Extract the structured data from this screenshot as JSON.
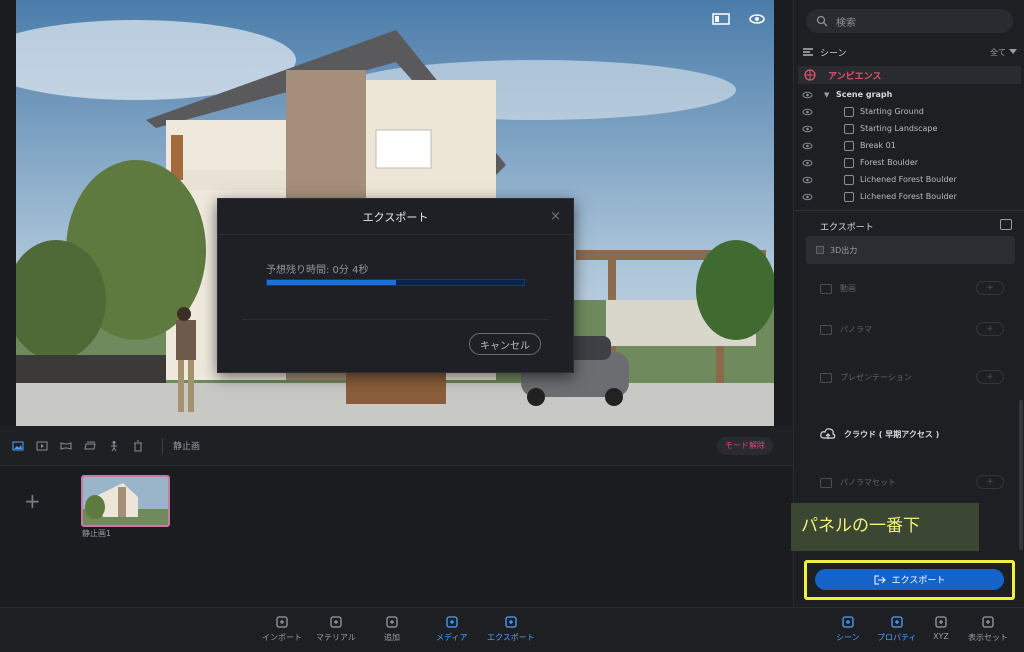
{
  "viewport": {
    "tools": [
      "layout-icon",
      "eye-icon"
    ]
  },
  "export_dialog": {
    "title": "エクスポート",
    "close": "×",
    "eta": "予想残り時間: 0分 4秒",
    "progress_percent": 50,
    "cancel_label": "キャンセル"
  },
  "media_toolbar": {
    "still_label": "静止画",
    "mode_switch_label": "モード解除"
  },
  "media": {
    "add_label": "+",
    "thumb_label": "静止画1"
  },
  "right_panel": {
    "search_placeholder": "検索",
    "scene_label": "シーン",
    "filter_label": "全て",
    "ambience_label": "アンビエンス",
    "tree": [
      {
        "label": "Scene graph",
        "type": "group"
      },
      {
        "label": "Starting Ground",
        "type": "item"
      },
      {
        "label": "Starting Landscape",
        "type": "item"
      },
      {
        "label": "Break 01",
        "type": "item"
      },
      {
        "label": "Forest Boulder",
        "type": "item"
      },
      {
        "label": "Lichened Forest Boulder",
        "type": "item"
      },
      {
        "label": "Lichened Forest Boulder",
        "type": "item"
      }
    ],
    "export_title": "エクスポート",
    "output_3d_label": "3D出力",
    "video_label": "動画",
    "panorama_label": "パノラマ",
    "presentation_label": "プレゼンテーション",
    "cloud_label": "クラウド ( 早期アクセス )",
    "panorama_set_label": "パノラマセット",
    "export_button_label": "エクスポート"
  },
  "annotation": {
    "text": "パネルの一番下"
  },
  "bottom_nav": {
    "left": [
      {
        "label": "インポート",
        "icon": "import-icon"
      },
      {
        "label": "マテリアル",
        "icon": "material-icon"
      },
      {
        "label": "追加",
        "icon": "add-object-icon"
      },
      {
        "label": "メディア",
        "icon": "media-icon",
        "active": true
      },
      {
        "label": "エクスポート",
        "icon": "export-icon",
        "active": true
      }
    ],
    "right": [
      {
        "label": "シーン",
        "icon": "scene-icon",
        "active": true
      },
      {
        "label": "プロパティ",
        "icon": "properties-icon",
        "active": true
      },
      {
        "label": "XYZ",
        "icon": "xyz-icon"
      },
      {
        "label": "表示セット",
        "icon": "display-set-icon"
      }
    ]
  },
  "colors": {
    "accent": "#1363c9",
    "highlight": "#f0f040",
    "ambience": "#e0566a"
  }
}
